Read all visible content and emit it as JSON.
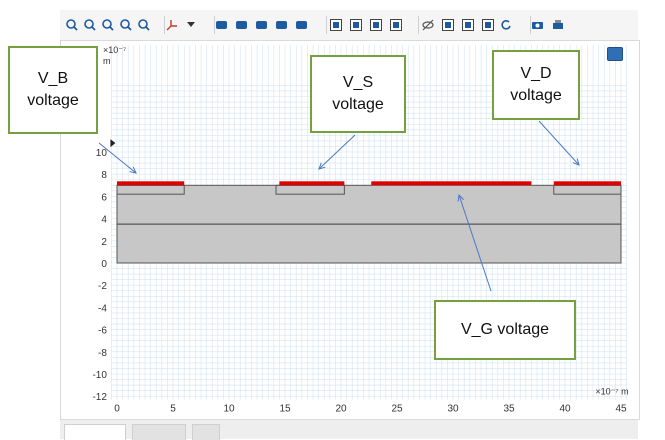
{
  "toolbar": {
    "icons": [
      "zoom-in-icon",
      "zoom-out-icon",
      "zoom-box-icon",
      "zoom-extents-icon",
      "zoom-to-selection-icon",
      "axis-orientation-icon",
      "dropdown-arrow-icon",
      "select-domain-icon",
      "select-boundary-icon",
      "select-edge-icon",
      "select-point-icon",
      "select-all-icon",
      "show-grid-icon",
      "show-geometry-icon",
      "show-mesh-icon",
      "show-labels-icon",
      "hide-icon",
      "view-icon",
      "view-settings-icon",
      "render-icon",
      "reset-view-icon",
      "camera-icon",
      "print-icon"
    ],
    "accent": "#1e5aa0"
  },
  "plot": {
    "y_exponent": "×10⁻⁷",
    "y_unit": "m",
    "x_exponent": "×10⁻⁷ m",
    "x_ticks": [
      "0",
      "5",
      "10",
      "15",
      "20",
      "25",
      "30",
      "35",
      "40",
      "45"
    ],
    "y_ticks": [
      "10",
      "8",
      "6",
      "4",
      "2",
      "0",
      "-2",
      "-4",
      "-6",
      "-8",
      "-10",
      "-12"
    ],
    "colors": {
      "grid": "#d3e4f1",
      "body": "#c7c7c7",
      "outline": "#555555",
      "contact": "#e00000",
      "arrow": "#4a77c4"
    }
  },
  "geometry_data": {
    "units": "1e-7 m",
    "body": {
      "x": [
        0,
        45
      ],
      "y": [
        0,
        7
      ]
    },
    "layer_line_y": 3.5,
    "wells": [
      {
        "name": "B",
        "x": [
          0,
          6
        ],
        "y": [
          6.2,
          7
        ]
      },
      {
        "name": "S",
        "x": [
          14.2,
          20.3
        ],
        "y": [
          6.2,
          7
        ]
      },
      {
        "name": "D",
        "x": [
          39,
          45
        ],
        "y": [
          6.2,
          7
        ]
      }
    ],
    "contacts": [
      {
        "name": "V_B",
        "x": [
          0,
          6
        ]
      },
      {
        "name": "V_S",
        "x": [
          14.5,
          20.3
        ]
      },
      {
        "name": "V_G",
        "x": [
          22.7,
          37
        ]
      },
      {
        "name": "V_D",
        "x": [
          39,
          45
        ]
      }
    ]
  },
  "callouts": [
    {
      "id": "vb",
      "text": "V_B\nvoltage"
    },
    {
      "id": "vs",
      "text": "V_S\nvoltage"
    },
    {
      "id": "vd",
      "text": "V_D\nvoltage"
    },
    {
      "id": "vg",
      "text": "V_G voltage"
    }
  ]
}
